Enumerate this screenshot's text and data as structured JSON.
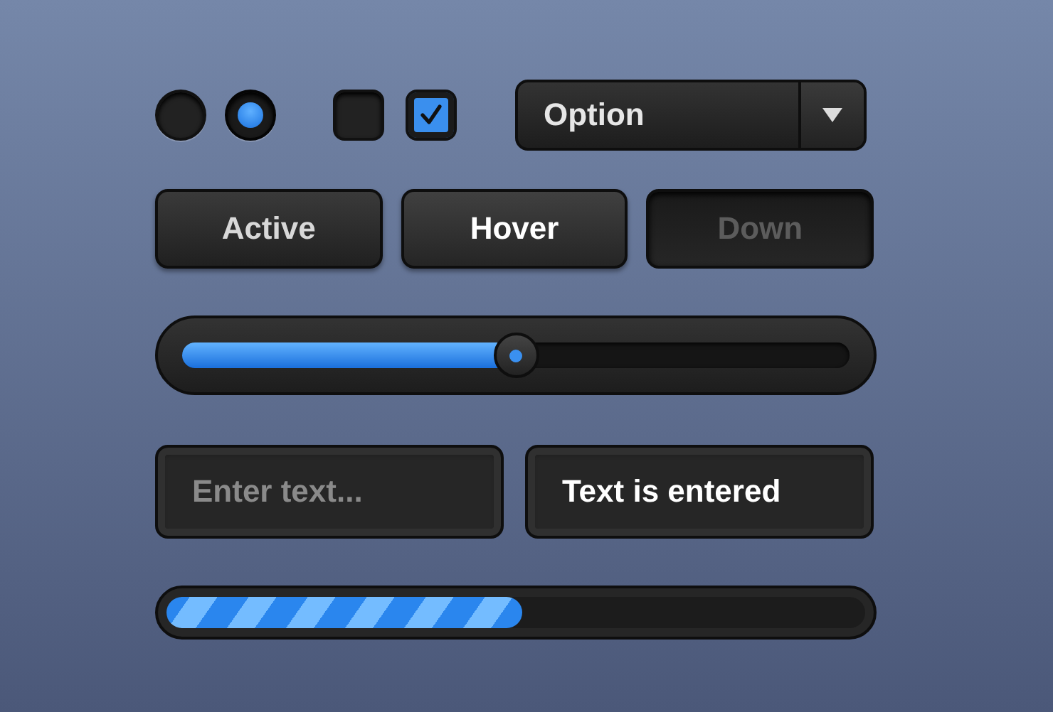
{
  "radios": [
    {
      "selected": false
    },
    {
      "selected": true
    }
  ],
  "checkboxes": [
    {
      "checked": false
    },
    {
      "checked": true
    }
  ],
  "dropdown": {
    "value": "Option"
  },
  "buttons": [
    {
      "label": "Active",
      "kind": "normal"
    },
    {
      "label": "Hover",
      "kind": "hover"
    },
    {
      "label": "Down",
      "kind": "pressed"
    }
  ],
  "slider": {
    "level": 0.5
  },
  "fields": [
    {
      "placeholder": "Enter text..."
    },
    {
      "value": "Text is entered"
    }
  ],
  "progress": {
    "level": 0.51
  }
}
